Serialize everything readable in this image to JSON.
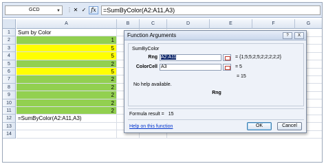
{
  "formula_bar": {
    "name_box": "GCD",
    "cancel_glyph": "✕",
    "enter_glyph": "✓",
    "fx_label": "fx",
    "formula": "=SumByColor(A2:A11,A3)"
  },
  "columns": [
    "A",
    "B",
    "C",
    "D",
    "E",
    "F",
    "G"
  ],
  "rows": [
    {
      "num": "1",
      "a": "Sum by Color",
      "fill": "none"
    },
    {
      "num": "2",
      "a": "1",
      "fill": "green"
    },
    {
      "num": "3",
      "a": "5",
      "fill": "yellow"
    },
    {
      "num": "4",
      "a": "5",
      "fill": "yellow"
    },
    {
      "num": "5",
      "a": "2",
      "fill": "green"
    },
    {
      "num": "6",
      "a": "5",
      "fill": "yellow"
    },
    {
      "num": "7",
      "a": "2",
      "fill": "green"
    },
    {
      "num": "8",
      "a": "2",
      "fill": "green"
    },
    {
      "num": "9",
      "a": "2",
      "fill": "green"
    },
    {
      "num": "10",
      "a": "2",
      "fill": "green"
    },
    {
      "num": "11",
      "a": "2",
      "fill": "green"
    },
    {
      "num": "12",
      "a": "=SumByColor(A2:A11,A3)",
      "fill": "none"
    },
    {
      "num": "13",
      "a": "",
      "fill": "none"
    },
    {
      "num": "14",
      "a": "",
      "fill": "none"
    }
  ],
  "colors": {
    "green": "#92d050",
    "yellow": "#ffff00"
  },
  "dialog": {
    "title": "Function Arguments",
    "help_glyph": "?",
    "close_glyph": "X",
    "function_name": "SumByColor",
    "args": [
      {
        "label": "Rng",
        "value": "A2:A11",
        "result": "= {1;5;5;2;5;2;2;2;2;2}"
      },
      {
        "label": "ColorCell",
        "value": "A3",
        "result": "= 5"
      }
    ],
    "function_result": "= 15",
    "help_text": "No help available.",
    "current_arg": "Rng",
    "formula_result_label": "Formula result =",
    "formula_result_value": "15",
    "help_link": "Help on this function",
    "ok_label": "OK",
    "cancel_label": "Cancel"
  }
}
